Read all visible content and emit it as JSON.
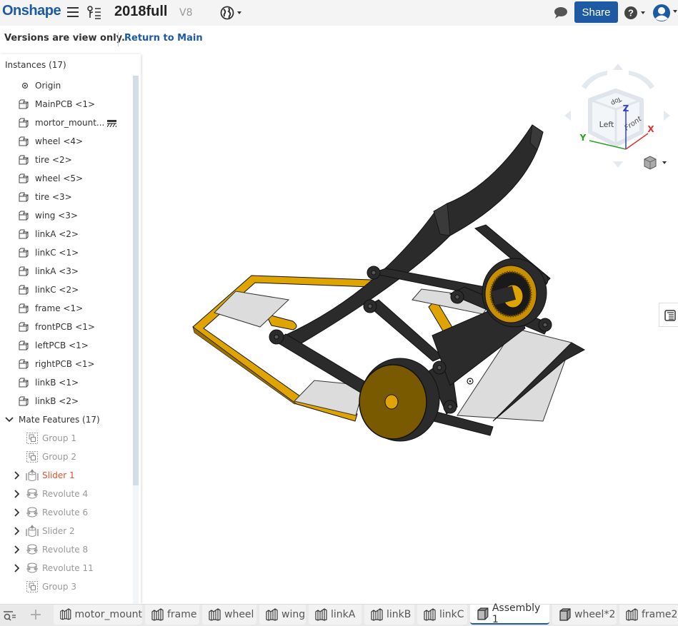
{
  "header": {
    "logo": "Onshape",
    "doc_title": "2018full",
    "version": "V8",
    "share_label": "Share",
    "icons": [
      "hamburger-menu-icon",
      "version-graph-icon",
      "globe-icon",
      "comment-icon",
      "help-icon",
      "user-icon"
    ]
  },
  "version_bar": {
    "message": "Versions are view only.",
    "return_link": "Return to Main"
  },
  "panel": {
    "title": "Instances (17)",
    "origin": "Origin",
    "instances": [
      {
        "label": "MainPCB <1>"
      },
      {
        "label": "mortor_mount...",
        "flag": "fixed-icon"
      },
      {
        "label": "wheel <4>"
      },
      {
        "label": "tire <2>"
      },
      {
        "label": "wheel <5>"
      },
      {
        "label": "tire <3>"
      },
      {
        "label": "wing <3>"
      },
      {
        "label": "linkA <2>"
      },
      {
        "label": "linkC <1>"
      },
      {
        "label": "linkA <3>"
      },
      {
        "label": "linkC <2>"
      },
      {
        "label": "frame <1>"
      },
      {
        "label": "frontPCB <1>"
      },
      {
        "label": "leftPCB <1>"
      },
      {
        "label": "rightPCB <1>"
      },
      {
        "label": "linkB <1>"
      },
      {
        "label": "linkB <2>"
      }
    ],
    "mate_section": "Mate Features (17)",
    "mates": [
      {
        "label": "Group 1",
        "type": "group",
        "expandable": false,
        "error": false
      },
      {
        "label": "Group 2",
        "type": "group",
        "expandable": false,
        "error": false
      },
      {
        "label": "Slider 1",
        "type": "slider",
        "expandable": true,
        "error": true
      },
      {
        "label": "Revolute 4",
        "type": "revolute",
        "expandable": true,
        "error": false
      },
      {
        "label": "Revolute 6",
        "type": "revolute",
        "expandable": true,
        "error": false
      },
      {
        "label": "Slider 2",
        "type": "slider",
        "expandable": true,
        "error": false
      },
      {
        "label": "Revolute 8",
        "type": "revolute",
        "expandable": true,
        "error": false
      },
      {
        "label": "Revolute 11",
        "type": "revolute",
        "expandable": true,
        "error": false
      },
      {
        "label": "Group 3",
        "type": "group",
        "expandable": false,
        "error": false
      }
    ]
  },
  "viewcube": {
    "faces": {
      "top": "Top",
      "left": "Left",
      "front": "Front"
    },
    "axes": {
      "x": "X",
      "y": "Y",
      "z": "Z"
    },
    "colors": {
      "x": "#e03030",
      "y": "#2aa02a",
      "z": "#3040d0"
    }
  },
  "tabs": [
    {
      "label": "motor_mount",
      "type": "part-studio",
      "active": false
    },
    {
      "label": "frame",
      "type": "part-studio",
      "active": false
    },
    {
      "label": "wheel",
      "type": "part-studio",
      "active": false
    },
    {
      "label": "wing",
      "type": "part-studio",
      "active": false
    },
    {
      "label": "linkA",
      "type": "part-studio",
      "active": false
    },
    {
      "label": "linkB",
      "type": "part-studio",
      "active": false
    },
    {
      "label": "linkC",
      "type": "part-studio",
      "active": false
    },
    {
      "label": "Assembly 1",
      "type": "assembly",
      "active": true
    },
    {
      "label": "wheel*2",
      "type": "assembly",
      "active": false
    },
    {
      "label": "frame2",
      "type": "part-studio",
      "active": false
    }
  ],
  "colors": {
    "brand": "#1d5aa3",
    "error": "#e0512b",
    "model_dark": "#2b2b2b",
    "model_gold": "#e0a400",
    "model_pcb": "#dcdcdc"
  }
}
